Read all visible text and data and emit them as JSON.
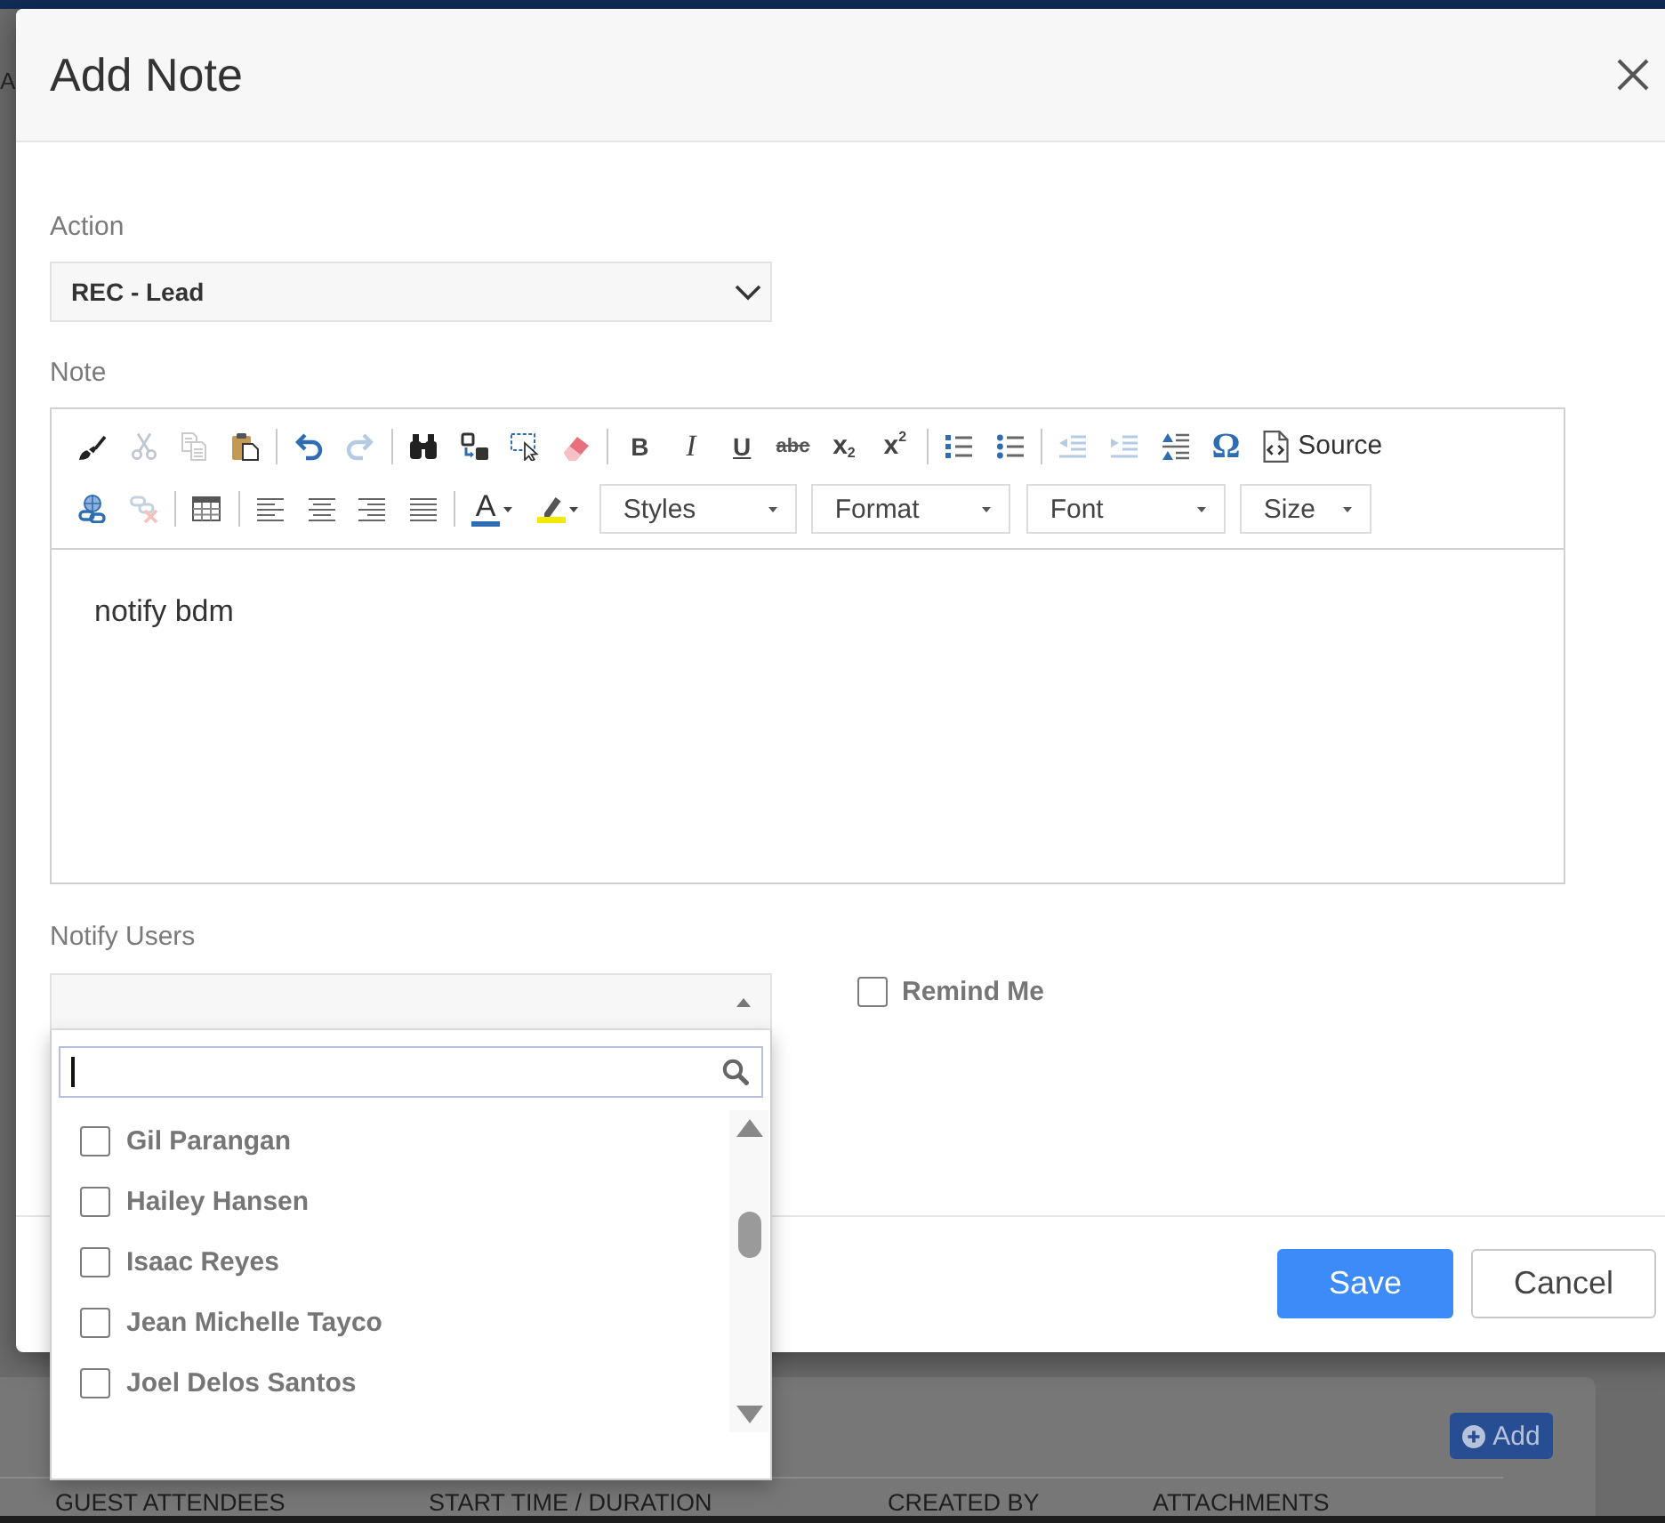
{
  "page": {
    "edge_letter": "A",
    "add_button": "Add",
    "columns": [
      "GUEST ATTENDEES",
      "START TIME / DURATION",
      "CREATED BY",
      "ATTACHMENTS"
    ]
  },
  "dialog": {
    "title": "Add Note",
    "action": {
      "label": "Action",
      "value": "REC - Lead"
    },
    "note": {
      "label": "Note",
      "toolbar_rows": [
        [
          [
            {
              "kind": "icon",
              "disabled": false
            },
            {
              "kind": "icon",
              "disabled": true
            },
            {
              "kind": "icon",
              "disabled": true
            },
            {
              "kind": "icon",
              "disabled": false
            }
          ],
          [
            {
              "kind": "icon",
              "disabled": false
            },
            {
              "kind": "icon",
              "disabled": true
            }
          ],
          [
            {
              "kind": "icon",
              "disabled": false
            },
            {
              "kind": "icon",
              "disabled": false
            },
            {
              "kind": "icon",
              "disabled": false
            },
            {
              "kind": "icon",
              "disabled": false
            }
          ],
          [
            {
              "kind": "bold",
              "label": "B",
              "disabled": false
            },
            {
              "kind": "italic",
              "label": "I",
              "disabled": false
            },
            {
              "kind": "underline",
              "label": "U",
              "disabled": false
            },
            {
              "kind": "strike",
              "label": "abc",
              "disabled": false
            },
            {
              "kind": "sub",
              "label": "x$_{2}$",
              "disabled": false
            },
            {
              "kind": "sup",
              "label": "x$^{2}$",
              "disabled": false
            }
          ],
          [
            {
              "kind": "icon",
              "disabled": false
            },
            {
              "kind": "icon",
              "disabled": false
            }
          ],
          [
            {
              "kind": "icon",
              "disabled": true
            },
            {
              "kind": "icon",
              "disabled": true
            },
            {
              "kind": "icon",
              "disabled": false
            },
            {
              "kind": "symbol",
              "label": "Ω",
              "disabled": false
            },
            {
              "kind": "source",
              "label": "Source",
              "disabled": false
            }
          ]
        ],
        [
          [
            {
              "kind": "icon",
              "disabled": false
            },
            {
              "kind": "icon",
              "disabled": true
            }
          ],
          [
            {
              "kind": "icon",
              "disabled": false
            }
          ],
          [
            {
              "kind": "icon",
              "disabled": false
            },
            {
              "kind": "icon",
              "disabled": false
            },
            {
              "kind": "icon",
              "disabled": false
            },
            {
              "kind": "icon",
              "disabled": false
            }
          ],
          [
            {
              "kind": "color",
              "label": "A",
              "disabled": false
            },
            {
              "kind": "icon-menu",
              "disabled": false
            },
            {
              "kind": "dropdown",
              "label": "Styles",
              "disabled": false
            },
            {
              "kind": "dropdown",
              "label": "Format",
              "disabled": false
            },
            {
              "kind": "dropdown",
              "label": "Font",
              "disabled": false
            },
            {
              "kind": "dropdown",
              "label": "Size",
              "disabled": false
            }
          ]
        ]
      ],
      "text": "notify bdm"
    },
    "notify_users": {
      "label": "Notify Users",
      "expanded": true,
      "users": [
        {
          "name": "Gil Parangan",
          "checked": false
        },
        {
          "name": "Hailey Hansen",
          "checked": false
        },
        {
          "name": "Isaac Reyes",
          "checked": false
        },
        {
          "name": "Jean Michelle Tayco",
          "checked": false
        },
        {
          "name": "Joel Delos Santos",
          "checked": false
        }
      ]
    },
    "remind_me": {
      "label": "Remind Me",
      "checked": false
    },
    "buttons": [
      {
        "label": "Save",
        "kind": "primary"
      },
      {
        "label": "Cancel",
        "kind": "secondary"
      }
    ]
  }
}
